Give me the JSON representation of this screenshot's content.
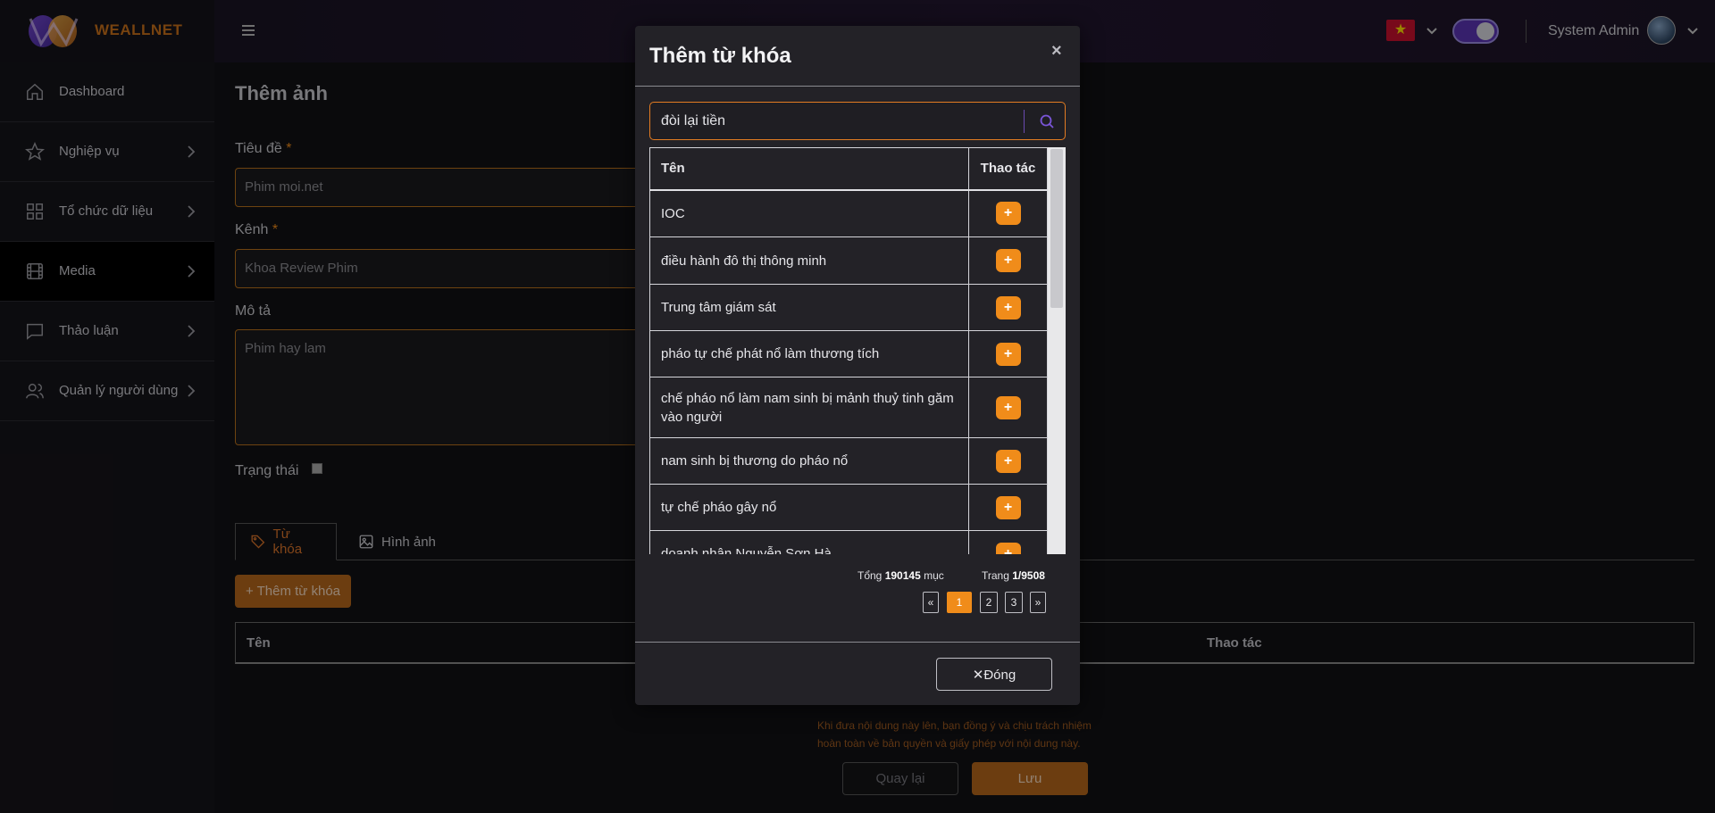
{
  "brand": {
    "name": "WEALLNET"
  },
  "sidebar": {
    "items": [
      {
        "label": "Dashboard",
        "icon": "home-icon"
      },
      {
        "label": "Nghiệp vụ",
        "icon": "star-icon"
      },
      {
        "label": "Tổ chức dữ liệu",
        "icon": "grid-icon"
      },
      {
        "label": "Media",
        "icon": "film-icon",
        "active": true
      },
      {
        "label": "Thảo luận",
        "icon": "chat-icon"
      },
      {
        "label": "Quản lý người dùng",
        "icon": "users-icon"
      }
    ]
  },
  "topbar": {
    "flag": "★",
    "user_name": "System Admin",
    "dark_mode": true
  },
  "form": {
    "page_title": "Thêm ảnh",
    "title_label": "Tiêu đề",
    "title_value": "Phim moi.net",
    "channel_label": "Kênh",
    "channel_value": "Khoa Review Phim",
    "desc_label": "Mô tả",
    "desc_value": "Phim hay lam",
    "status_label": "Trạng thái",
    "required_mark": "*",
    "tabs": [
      {
        "label": "Từ khóa",
        "active": true
      },
      {
        "label": "Hình ảnh",
        "active": false
      }
    ],
    "add_keyword_button": "+ Thêm từ khóa",
    "table_headers": [
      "Tên",
      "Thao tác"
    ],
    "notice": "Khi đưa nội dung này lên, bạn đồng ý và chịu trách nhiệm hoàn toàn về bản quyền và giấy phép với nội dung này.",
    "back_button": "Quay lại",
    "save_button": "Lưu"
  },
  "modal": {
    "title": "Thêm từ khóa",
    "close_symbol": "×",
    "search_value": "đòi lại tiền",
    "columns": {
      "name": "Tên",
      "action": "Thao tác"
    },
    "rows": [
      "IOC",
      "điều hành đô thị thông minh",
      "Trung tâm giám sát",
      "pháo tự chế phát nổ làm thương tích",
      "chế pháo nổ làm nam sinh bị mảnh thuỷ tinh găm vào người",
      "nam sinh bị thương do pháo nổ",
      "tự chế pháo gây nổ",
      "doanh nhân Nguyễn Sơn Hà"
    ],
    "add_symbol": "+",
    "total_prefix": "Tổng",
    "total_count": "190145",
    "total_suffix": "mục",
    "page_prefix": "Trang",
    "page_value": "1/9508",
    "pages": [
      "«",
      "1",
      "2",
      "3",
      "»"
    ],
    "current_page": "1",
    "close_button": "✕Đóng"
  },
  "colors": {
    "accent": "#f08c1a",
    "brand": "#c9701a",
    "toggle": "#5b35b5"
  }
}
